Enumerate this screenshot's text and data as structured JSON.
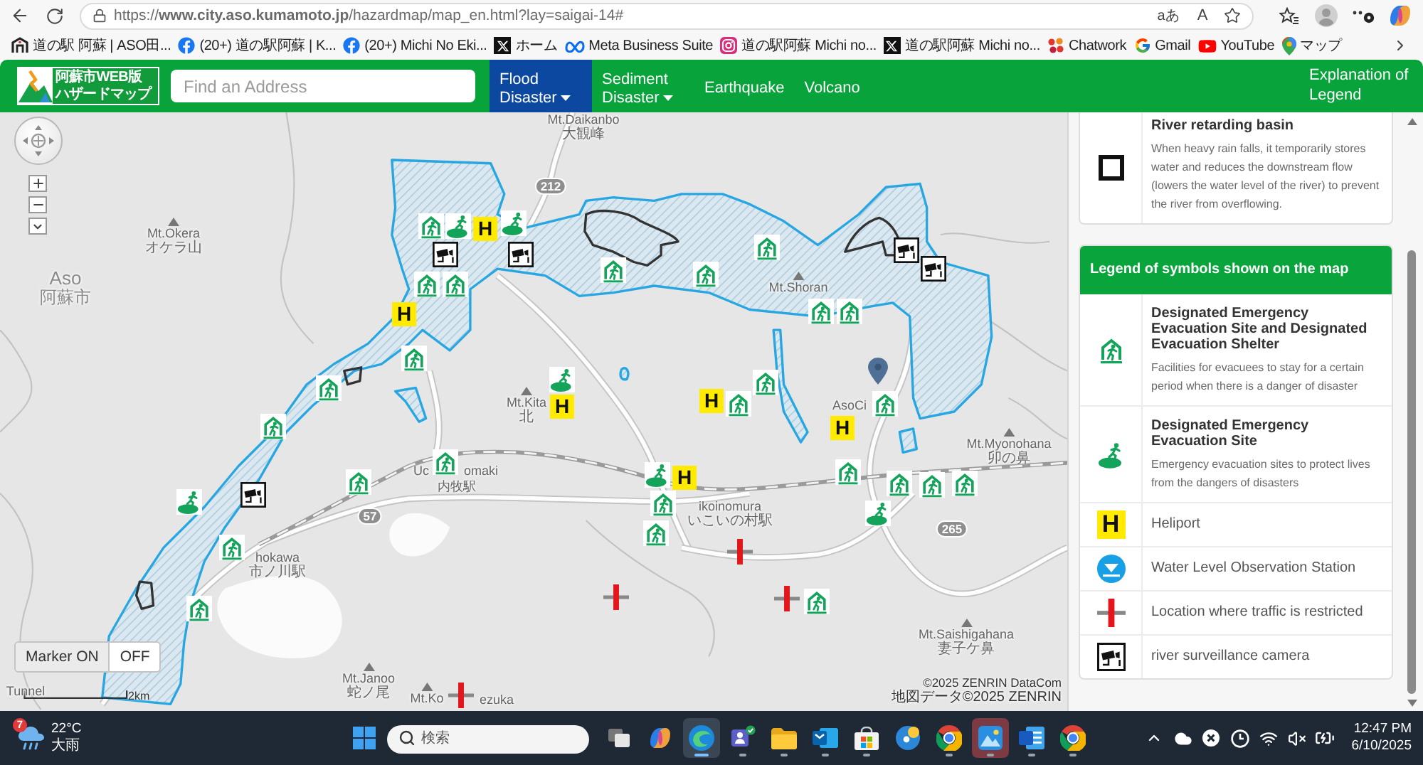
{
  "browser": {
    "url": "https://**www.city.aso.kumamoto.jp**/hazardmap/map_en.html?lay=saigai-14#",
    "translate_label": "aあ",
    "read_aloud_label": "A"
  },
  "bookmarks": [
    {
      "title": "道の駅 阿蘇 | ASO田..."
    },
    {
      "title": "(20+) 道の駅阿蘇 | K..."
    },
    {
      "title": "(20+) Michi No Eki..."
    },
    {
      "title": "ホーム"
    },
    {
      "title": "Meta Business Suite"
    },
    {
      "title": "道の駅阿蘇 Michi no..."
    },
    {
      "title": "道の駅阿蘇 Michi no..."
    },
    {
      "title": "Chatwork"
    },
    {
      "title": "Gmail"
    },
    {
      "title": "YouTube"
    },
    {
      "title": "マップ"
    }
  ],
  "header": {
    "logo_lines": [
      "阿蘇市WEB版",
      "ハザードマップ"
    ],
    "search": {
      "placeholder": "Find an Address"
    },
    "menu": [
      {
        "label": "Flood Disaster",
        "dropdown": true,
        "selected": true
      },
      {
        "label": "Sediment Disaster",
        "dropdown": true,
        "selected": false
      },
      {
        "label": "Earthquake",
        "dropdown": false,
        "selected": false
      },
      {
        "label": "Volcano",
        "dropdown": false,
        "selected": false
      }
    ],
    "legend_link": "Explanation of Legend"
  },
  "map": {
    "places": [
      {
        "kind": "label",
        "name": "Mt.Daikanbo",
        "local_name": "大観峰"
      },
      {
        "kind": "peak",
        "name": "Mt.Okera",
        "local_name": "オケラ山"
      },
      {
        "kind": "city",
        "name": "Aso",
        "local_name": "阿蘇市"
      },
      {
        "kind": "peak",
        "name": "Mt.Shoran"
      },
      {
        "kind": "peak",
        "name": "Mt.Kita",
        "local_name": "北"
      },
      {
        "kind": "label",
        "name": "AsoCi"
      },
      {
        "kind": "label",
        "name": "Uc"
      },
      {
        "kind": "label",
        "name": "omaki"
      },
      {
        "kind": "label",
        "name": "内牧駅"
      },
      {
        "kind": "label",
        "name": "ikoinomura",
        "local_name": "いこいの村駅"
      },
      {
        "kind": "label",
        "name": "hokawa",
        "local_name": "市ノ川駅"
      },
      {
        "kind": "peak",
        "name": "Mt.Myonohana",
        "local_name": "卯の鼻"
      },
      {
        "kind": "peak",
        "name": "Mt.Saishigahana",
        "local_name": "妻子ケ鼻"
      },
      {
        "kind": "peak",
        "name": "Mt.Janoo",
        "local_name": "蛇ノ尾"
      },
      {
        "kind": "peak",
        "name": "Mt.Ko"
      },
      {
        "kind": "label",
        "name": "ezuka"
      },
      {
        "kind": "label",
        "name": "Tunnel"
      }
    ],
    "route_numbers": [
      "212",
      "57",
      "265"
    ],
    "markers": [
      {
        "kind": "shelter"
      },
      {
        "kind": "site"
      },
      {
        "kind": "heliport",
        "symbol": "H"
      },
      {
        "kind": "site"
      },
      {
        "kind": "camera"
      },
      {
        "kind": "camera"
      },
      {
        "kind": "shelter"
      },
      {
        "kind": "shelter"
      },
      {
        "kind": "heliport",
        "symbol": "H"
      },
      {
        "kind": "shelter"
      },
      {
        "kind": "shelter"
      },
      {
        "kind": "shelter"
      },
      {
        "kind": "camera"
      },
      {
        "kind": "site"
      },
      {
        "kind": "shelter"
      },
      {
        "kind": "shelter"
      },
      {
        "kind": "shelter"
      },
      {
        "kind": "shelter"
      },
      {
        "kind": "heliport",
        "symbol": "H"
      },
      {
        "kind": "site"
      },
      {
        "kind": "shelter"
      },
      {
        "kind": "shelter"
      },
      {
        "kind": "shelter"
      },
      {
        "kind": "shelter"
      },
      {
        "kind": "shelter"
      },
      {
        "kind": "camera"
      },
      {
        "kind": "camera"
      },
      {
        "kind": "heliport",
        "symbol": "H"
      },
      {
        "kind": "shelter"
      },
      {
        "kind": "shelter"
      },
      {
        "kind": "pin"
      },
      {
        "kind": "shelter"
      },
      {
        "kind": "heliport",
        "symbol": "H"
      },
      {
        "kind": "shelter"
      },
      {
        "kind": "shelter"
      },
      {
        "kind": "shelter"
      },
      {
        "kind": "shelter"
      },
      {
        "kind": "site"
      },
      {
        "kind": "heliport",
        "symbol": "H"
      },
      {
        "kind": "site"
      },
      {
        "kind": "shelter"
      },
      {
        "kind": "shelter"
      },
      {
        "kind": "traffic"
      },
      {
        "kind": "traffic"
      },
      {
        "kind": "traffic"
      },
      {
        "kind": "shelter"
      },
      {
        "kind": "traffic"
      }
    ],
    "marker_toggle": [
      {
        "label": "Marker ON",
        "selected": true
      },
      {
        "label": "OFF",
        "selected": false
      }
    ],
    "scale": "2km",
    "attribution": [
      "©2025 ZENRIN DataCom",
      "地図データ©2025 ZENRIN"
    ]
  },
  "legend": {
    "retarding_basin": {
      "title": "River retarding basin",
      "description": "When heavy rain falls, it temporarily stores water and reduces the downstream flow (lowers the water level of the river) to prevent the river from overflowing."
    },
    "heading": "Legend of symbols shown on the map",
    "symbols": [
      {
        "kind": "shelter",
        "title": "Designated Emergency Evacuation Site and Designated Evacuation Shelter",
        "description": "Facilities for evacuees to stay for a certain period when there is a danger of disaster"
      },
      {
        "kind": "site",
        "title": "Designated Emergency Evacuation Site",
        "description": "Emergency evacuation sites to protect lives from the dangers of disasters"
      },
      {
        "kind": "heliport",
        "title": "Heliport",
        "symbol": "H"
      },
      {
        "kind": "water_level",
        "title": "Water Level Observation Station"
      },
      {
        "kind": "traffic",
        "title": "Location where traffic is restricted"
      },
      {
        "kind": "camera",
        "title": "river surveillance camera"
      }
    ]
  },
  "taskbar": {
    "weather": {
      "alert_badge": "7",
      "temperature": "22°C",
      "condition": "大雨"
    },
    "search": {
      "placeholder": "検索"
    },
    "apps": [
      {
        "running": false,
        "selected": false,
        "flashing": false
      },
      {
        "running": false,
        "selected": false,
        "flashing": false
      },
      {
        "running": true,
        "selected": true,
        "flashing": false
      },
      {
        "running": true,
        "selected": false,
        "flashing": false
      },
      {
        "running": true,
        "selected": false,
        "flashing": false
      },
      {
        "running": true,
        "selected": false,
        "flashing": false
      },
      {
        "running": true,
        "selected": false,
        "flashing": false
      },
      {
        "running": false,
        "selected": false,
        "flashing": false
      },
      {
        "running": true,
        "selected": false,
        "flashing": false
      },
      {
        "running": true,
        "selected": false,
        "flashing": true
      },
      {
        "running": true,
        "selected": false,
        "flashing": false
      },
      {
        "running": true,
        "selected": false,
        "flashing": false
      }
    ],
    "clock": {
      "time": "12:47 PM",
      "date": "6/10/2025"
    }
  }
}
